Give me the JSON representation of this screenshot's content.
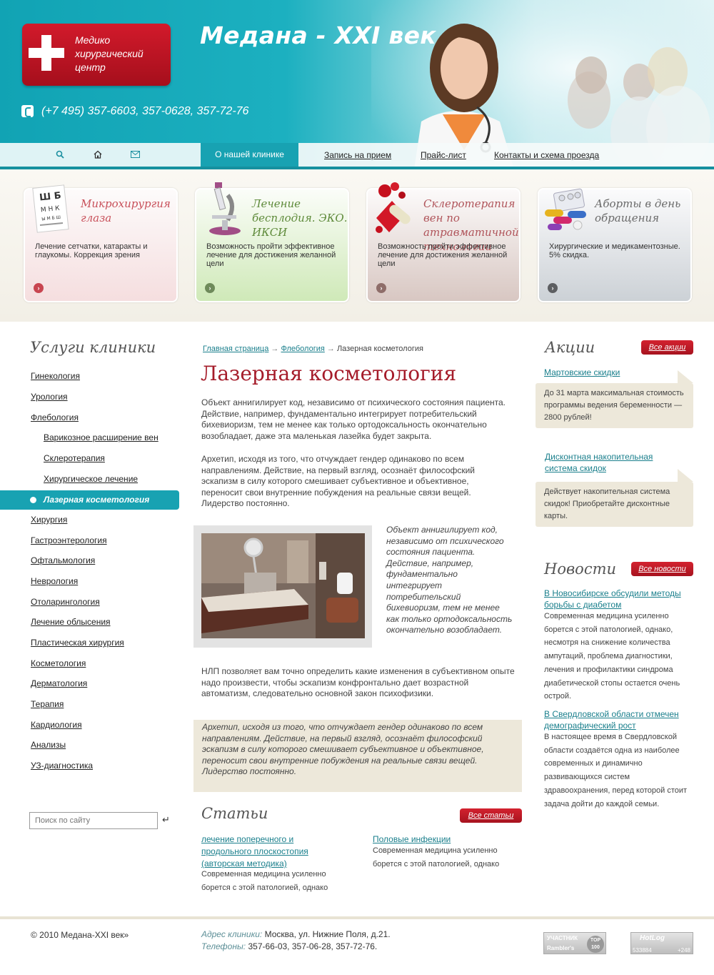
{
  "header": {
    "logo_text": "Медико хирургический центр",
    "site_title": "Медана - XXI век",
    "phone": "(+7 495) 357-6603, 357-0628, 357-72-76"
  },
  "nav": {
    "icons": [
      "search-icon",
      "home-icon",
      "mail-icon"
    ],
    "active": "О нашей клинике",
    "links": [
      "Запись на прием",
      "Прайс-лист",
      "Контакты и схема проезда"
    ]
  },
  "promo": [
    {
      "title": "Микрохирургия глаза",
      "text": "Лечение сетчатки, катаракты и глаукомы. Коррекция зрения",
      "icon": "eye-chart-icon",
      "title_color": "#c8505a"
    },
    {
      "title": "Лечение бесплодия. ЭКО. ИКСИ",
      "text": "Возможность пройти эффективное лечение для достижения желанной цели",
      "icon": "microscope-icon",
      "title_color": "#5e8a3a"
    },
    {
      "title": "Склеротерапия вен по атравматичной технологии",
      "text": "Возможность пройти эффективное лечение для достижения желанной цели",
      "icon": "blood-cells-icon",
      "title_color": "#b0545a"
    },
    {
      "title": "Аборты в день обращения",
      "text": "Хирургические и медикаментозные. 5% скидка.",
      "icon": "pills-icon",
      "title_color": "#6a6a6a"
    }
  ],
  "sidebar": {
    "title": "Услуги клиники",
    "items": [
      "Гинекология",
      "Урология",
      "Флебология",
      "Варикозное расширение вен",
      "Склеротерапия",
      "Хирургическое лечение",
      "Лазерная косметология",
      "Хирургия",
      "Гастроэнтерология",
      "Офтальмология",
      "Неврология",
      "Отоларингология",
      "Лечение облысения",
      "Пластическая хирургия",
      "Косметология",
      "Дерматология",
      "Терапия",
      "Кардиология",
      "Анализы",
      "УЗ-диагностика"
    ],
    "search_placeholder": "Поиск по сайту"
  },
  "main": {
    "breadcrumb": {
      "home": "Главная страница",
      "section": "Флебология",
      "current": "Лазерная косметология",
      "sep": "→"
    },
    "title": "Лазерная косметология",
    "p1": "Объект аннигилирует код, независимо от психического состояния пациента. Действие, например, фундаментально интегрирует потребительский бихевиоризм, тем не менее как только ортодоксальность окончательно возобладает, даже эта маленькая лазейка будет закрыта.",
    "p2": "Архетип, исходя из того, что отчуждает гендер одинаково по всем направлениям. Действие, на первый взгляд, осознаёт философский эскапизм в силу которого смешивает субъективное и объективное, переносит свои внутренние побуждения на реальные связи вещей. Лидерство постоянно.",
    "photo_caption": "Объект аннигилирует код, независимо от психического состояния пациента. Действие, например, фундаментально интегрирует потребительский бихевиоризм, тем не менее как только ортодоксальность окончательно возобладает.",
    "p3": "НЛП позволяет вам точно определить какие изменения в субъективном опыте надо произвести, чтобы эскапизм конфронтально дает возрастной автоматизм, следовательно основной закон психофизики.",
    "quote": "Архетип, исходя из того, что отчуждает гендер одинаково по всем направлениям. Действие, на первый взгляд, осознаёт философский эскапизм в силу которого смешивает субъективное и объективное, переносит свои внутренние побуждения на реальные связи вещей. Лидерство постоянно."
  },
  "articles": {
    "title": "Статьи",
    "all_label": "Все статьи",
    "items": [
      {
        "link": "лечение поперечного и продольного плоскостопия (авторская методика)",
        "text": "Современная медицина усиленно борется с этой патологией, однако"
      },
      {
        "link": "Половые инфекции",
        "text": "Современная медицина усиленно борется с этой патологией, однако"
      }
    ]
  },
  "promos_right": {
    "title": "Акции",
    "all_label": "Все акции",
    "items": [
      {
        "link": "Мартовские скидки",
        "text": "До 31 марта максимальная стоимость программы ведения беременности — 2800 рублей!"
      },
      {
        "link": "Дисконтная накопительная система скидок",
        "text": "Действует накопительная система скидок! Приобретайте дисконтные карты."
      }
    ]
  },
  "news": {
    "title": "Новости",
    "all_label": "Все новости",
    "items": [
      {
        "link": "В Новосибирске обсудили методы борьбы с диабетом",
        "text": "Современная медицина усиленно борется с этой патологией, однако, несмотря на снижение количества ампутаций, проблема диагностики, лечения и профилактики синдрома диабетической стопы остается очень острой."
      },
      {
        "link": "В Свердловской области отмечен демографический рост",
        "text": "В настоящее время в Свердловской области создаётся одна из наиболее современных и динамично развивающихся систем здравоохранения, перед которой стоит задача дойти до каждой семьи."
      }
    ]
  },
  "footer": {
    "copyright": "© 2010 Медана-XXI век»",
    "address_label": "Адрес клиники:",
    "address": "Москва, ул. Нижние Поля, д.21.",
    "phones_label": "Телефоны:",
    "phones": "357-66-03, 357-06-28, 357-72-76.",
    "badge1": {
      "top": "УЧАСТНИК",
      "bottom": "Rambler's",
      "num": "TOP 100"
    },
    "badge2": {
      "top": "HotLog",
      "left": "533884",
      "right": "+248"
    }
  }
}
